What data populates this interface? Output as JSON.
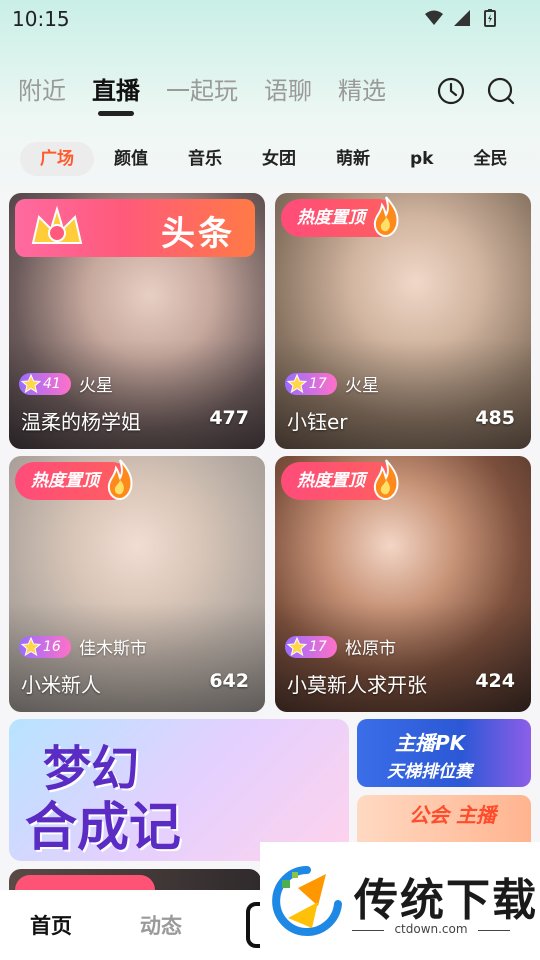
{
  "status_bar": {
    "time": "10:15",
    "icons": [
      "wifi-icon",
      "signal-icon",
      "battery-icon"
    ]
  },
  "top_tabs": [
    {
      "label": "附近",
      "active": false
    },
    {
      "label": "直播",
      "active": true
    },
    {
      "label": "一起玩",
      "active": false
    },
    {
      "label": "语聊",
      "active": false
    },
    {
      "label": "精选",
      "active": false
    }
  ],
  "top_actions": [
    "history-clock-icon",
    "search-icon"
  ],
  "sub_tabs": [
    {
      "label": "广场",
      "active": true
    },
    {
      "label": "颜值",
      "active": false
    },
    {
      "label": "音乐",
      "active": false
    },
    {
      "label": "女团",
      "active": false
    },
    {
      "label": "萌新",
      "active": false
    },
    {
      "label": "pk",
      "active": false
    },
    {
      "label": "全民",
      "active": false
    }
  ],
  "cards": [
    {
      "badge": "头条",
      "badge_type": "headline",
      "level": "41",
      "city": "火星",
      "title": "温柔的杨学姐",
      "viewers": "477"
    },
    {
      "badge": "热度置顶",
      "badge_type": "hot",
      "level": "17",
      "city": "火星",
      "title": "小钰er",
      "viewers": "485"
    },
    {
      "badge": "热度置顶",
      "badge_type": "hot",
      "level": "16",
      "city": "佳木斯市",
      "title": "小米新人",
      "viewers": "642"
    },
    {
      "badge": "热度置顶",
      "badge_type": "hot",
      "level": "17",
      "city": "松原市",
      "title": "小莫新人求开张",
      "viewers": "424"
    }
  ],
  "banners": {
    "event_line1": "梦幻",
    "event_line2": "合成记",
    "pk_line1": "主播PK",
    "pk_line2": "天梯排位赛",
    "guild": "公会 主播"
  },
  "bottom_nav": [
    {
      "label": "首页",
      "active": true
    },
    {
      "label": "动态",
      "active": false
    }
  ],
  "watermark": {
    "text": "传统下载",
    "url": "ctdown.com"
  },
  "colors": {
    "accent": "#ff5a2c",
    "hot_badge": "#ff4c7a",
    "level_start": "#9b6cff",
    "level_end": "#ff71c7"
  }
}
